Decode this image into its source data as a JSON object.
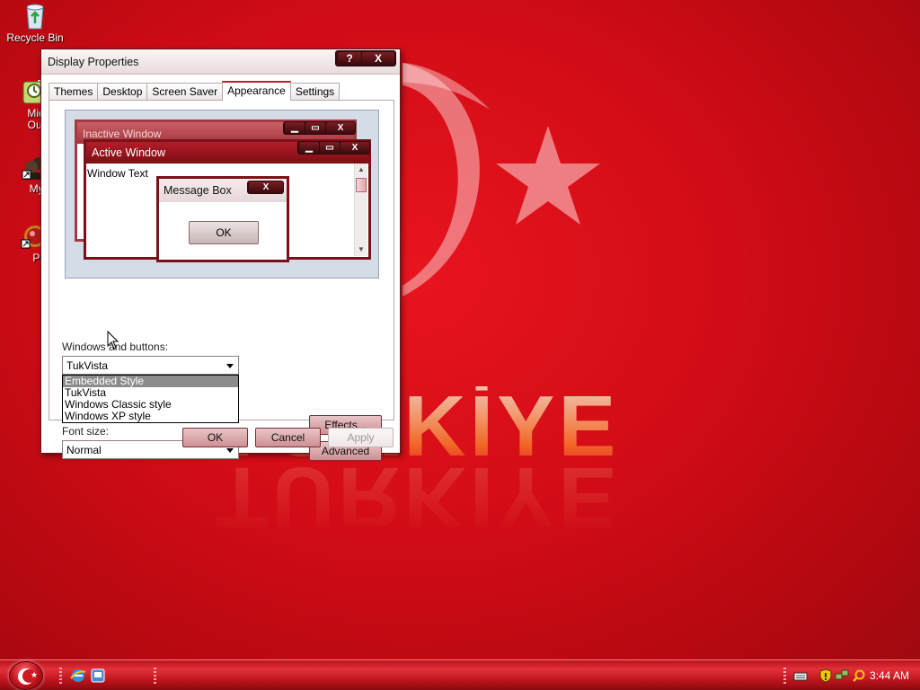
{
  "desktop": {
    "icons": [
      {
        "label": "Recycle Bin",
        "icon": "recycle-bin-icon"
      },
      {
        "label": "Micro",
        "label2": "Outlo",
        "icon": "outlook-icon"
      },
      {
        "label": "MyPa",
        "icon": "mypal-icon"
      },
      {
        "label": "Peg",
        "icon": "pegasus-icon"
      }
    ],
    "wallpaper_text": "TÜRKİYE"
  },
  "dialog": {
    "title": "Display Properties",
    "help_label": "?",
    "close_label": "X",
    "tabs": [
      {
        "label": "Themes"
      },
      {
        "label": "Desktop"
      },
      {
        "label": "Screen Saver"
      },
      {
        "label": "Appearance",
        "active": true
      },
      {
        "label": "Settings"
      }
    ],
    "preview": {
      "inactive_title": "Inactive Window",
      "active_title": "Active Window",
      "window_text": "Window Text",
      "message_box_title": "Message Box",
      "ok_label": "OK",
      "close_glyph": "X"
    },
    "windows_buttons": {
      "label": "Windows and buttons:",
      "value": "TukVista",
      "options": [
        {
          "label": "Embedded Style",
          "highlighted": true
        },
        {
          "label": "TukVista"
        },
        {
          "label": "Windows Classic style"
        },
        {
          "label": "Windows XP style"
        }
      ]
    },
    "font_size": {
      "label": "Font size:",
      "value": "Normal"
    },
    "effects_label": "Effects...",
    "advanced_label": "Advanced",
    "ok_label": "OK",
    "cancel_label": "Cancel",
    "apply_label": "Apply"
  },
  "taskbar": {
    "clock": "3:44 AM",
    "quick_launch": [
      "internet-explorer-icon",
      "show-desktop-icon"
    ],
    "tray": [
      "keyboard-icon",
      "security-shield-icon",
      "network-icon",
      "search-icon"
    ]
  },
  "colors": {
    "accent": "#b0262e",
    "wallpaper": "#d10c16"
  }
}
